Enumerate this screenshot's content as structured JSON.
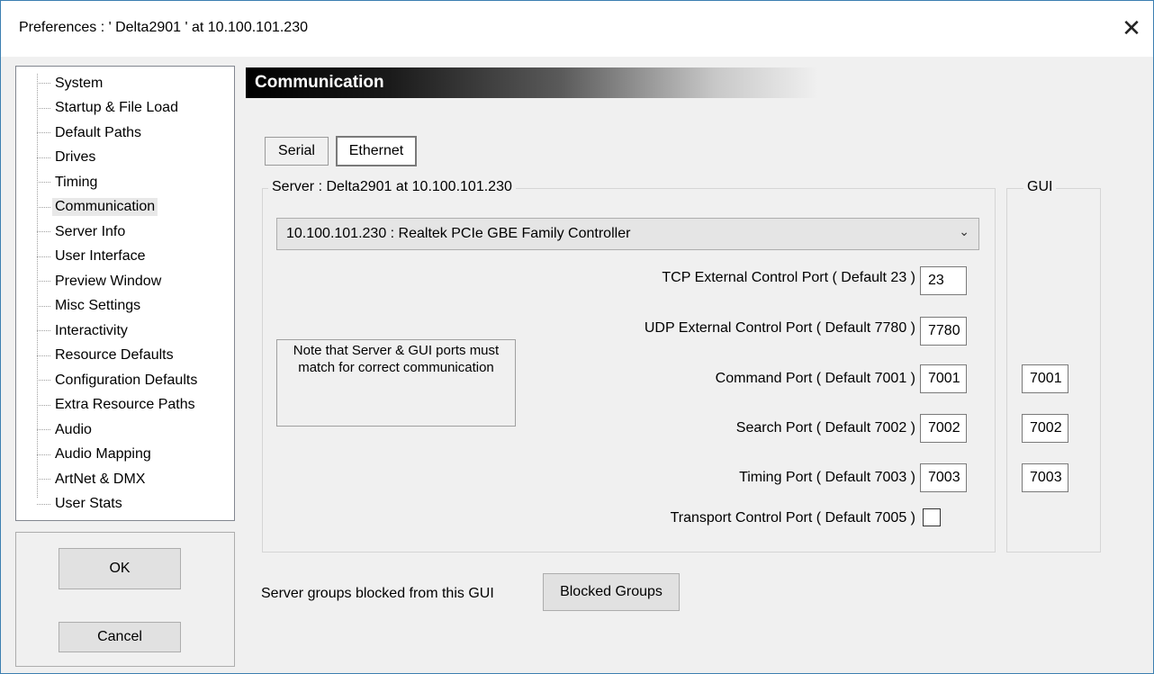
{
  "window": {
    "title": "Preferences  :  ' Delta2901 '  at  10.100.101.230",
    "close_glyph": "✕"
  },
  "nav": {
    "items": [
      {
        "label": "System"
      },
      {
        "label": "Startup & File Load"
      },
      {
        "label": "Default Paths"
      },
      {
        "label": "Drives"
      },
      {
        "label": "Timing"
      },
      {
        "label": "Communication",
        "selected": true
      },
      {
        "label": "Server Info"
      },
      {
        "label": "User Interface"
      },
      {
        "label": "Preview Window"
      },
      {
        "label": "Misc Settings"
      },
      {
        "label": "Interactivity"
      },
      {
        "label": "Resource Defaults"
      },
      {
        "label": "Configuration Defaults"
      },
      {
        "label": "Extra Resource Paths"
      },
      {
        "label": "Audio"
      },
      {
        "label": "Audio Mapping"
      },
      {
        "label": "ArtNet & DMX"
      },
      {
        "label": "User Stats"
      }
    ]
  },
  "buttons": {
    "ok": "OK",
    "cancel": "Cancel"
  },
  "panel": {
    "header": "Communication",
    "tabs": {
      "serial": "Serial",
      "ethernet": "Ethernet",
      "active": "Ethernet"
    },
    "server_group_label": "Server : Delta2901  at  10.100.101.230",
    "gui_group_label": "GUI",
    "adapter_select": "10.100.101.230 : Realtek PCIe GBE Family Controller",
    "note": "Note that Server & GUI ports must match for correct communication",
    "ports": {
      "tcp_label": "TCP External Control Port ( Default 23 )",
      "tcp_value": "23",
      "udp_label": "UDP External Control Port ( Default 7780 )",
      "udp_value": "7780",
      "command_label": "Command Port ( Default 7001 )",
      "command_server": "7001",
      "command_gui": "7001",
      "search_label": "Search Port ( Default 7002 )",
      "search_server": "7002",
      "search_gui": "7002",
      "timing_label": "Timing Port ( Default 7003 )",
      "timing_server": "7003",
      "timing_gui": "7003",
      "transport_label": "Transport Control Port ( Default 7005 )",
      "transport_checked": false
    },
    "blocked_label": "Server groups blocked from this GUI",
    "blocked_button": "Blocked Groups"
  }
}
